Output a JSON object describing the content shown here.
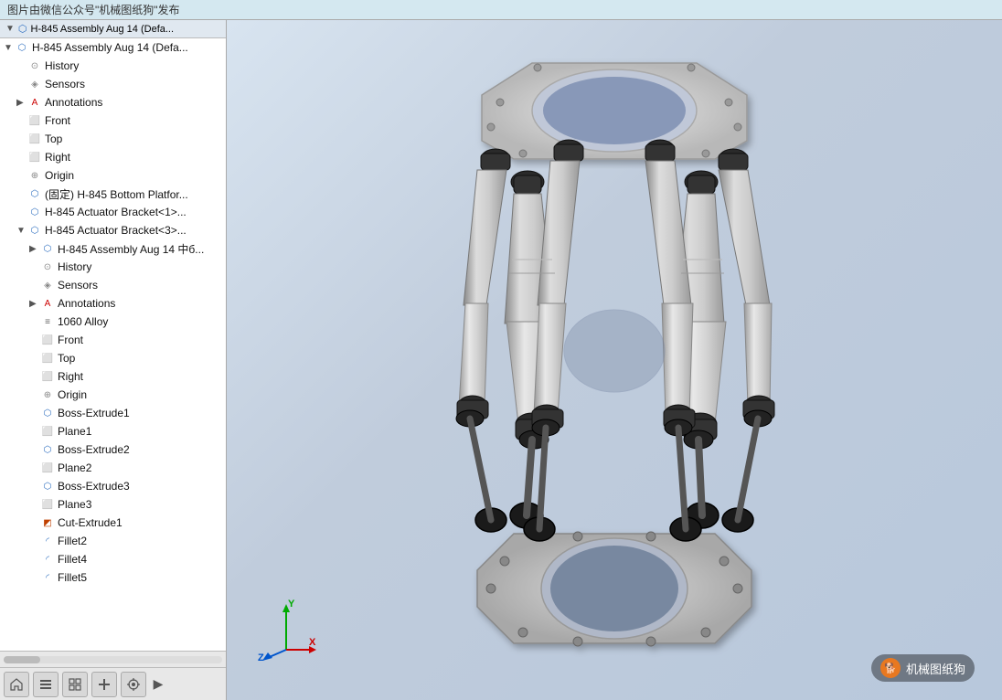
{
  "banner": {
    "text": "图片由微信公众号\"机械图纸狗\"发布"
  },
  "sidebar": {
    "header": {
      "title": "H-845 Assembly Aug 14  (Defa..."
    },
    "items": [
      {
        "id": "root-assembly",
        "indent": 0,
        "arrow": "▼",
        "icon": "assembly",
        "label": "H-845 Assembly Aug 14  (Defa...",
        "level": 0
      },
      {
        "id": "history-1",
        "indent": 1,
        "arrow": "",
        "icon": "history",
        "label": "History",
        "level": 1
      },
      {
        "id": "sensors-1",
        "indent": 1,
        "arrow": "",
        "icon": "sensors",
        "label": "Sensors",
        "level": 1
      },
      {
        "id": "annotations-1",
        "indent": 1,
        "arrow": "▶",
        "icon": "annotations",
        "label": "Annotations",
        "level": 1
      },
      {
        "id": "front-1",
        "indent": 1,
        "arrow": "",
        "icon": "plane",
        "label": "Front",
        "level": 1
      },
      {
        "id": "top-1",
        "indent": 1,
        "arrow": "",
        "icon": "plane",
        "label": "Top",
        "level": 1
      },
      {
        "id": "right-1",
        "indent": 1,
        "arrow": "",
        "icon": "plane",
        "label": "Right",
        "level": 1
      },
      {
        "id": "origin-1",
        "indent": 1,
        "arrow": "",
        "icon": "origin",
        "label": "Origin",
        "level": 1
      },
      {
        "id": "bottom-platform",
        "indent": 1,
        "arrow": "",
        "icon": "component",
        "label": "(固定) H-845 Bottom Platfor...",
        "level": 1
      },
      {
        "id": "actuator-1",
        "indent": 1,
        "arrow": "",
        "icon": "component",
        "label": "H-845 Actuator Bracket<1>...",
        "level": 1
      },
      {
        "id": "actuator-3",
        "indent": 1,
        "arrow": "▼",
        "icon": "component",
        "label": "H-845 Actuator Bracket<3>...",
        "level": 1
      },
      {
        "id": "sub-assembly",
        "indent": 2,
        "arrow": "▶",
        "icon": "assembly",
        "label": "H-845 Assembly Aug 14 中б...",
        "level": 2
      },
      {
        "id": "history-2",
        "indent": 2,
        "arrow": "",
        "icon": "history",
        "label": "History",
        "level": 2
      },
      {
        "id": "sensors-2",
        "indent": 2,
        "arrow": "",
        "icon": "sensors",
        "label": "Sensors",
        "level": 2
      },
      {
        "id": "annotations-2",
        "indent": 2,
        "arrow": "▶",
        "icon": "annotations",
        "label": "Annotations",
        "level": 2
      },
      {
        "id": "material",
        "indent": 2,
        "arrow": "",
        "icon": "material",
        "label": "1060 Alloy",
        "level": 2
      },
      {
        "id": "front-2",
        "indent": 2,
        "arrow": "",
        "icon": "plane",
        "label": "Front",
        "level": 2
      },
      {
        "id": "top-2",
        "indent": 2,
        "arrow": "",
        "icon": "plane",
        "label": "Top",
        "level": 2
      },
      {
        "id": "right-2",
        "indent": 2,
        "arrow": "",
        "icon": "plane",
        "label": "Right",
        "level": 2
      },
      {
        "id": "origin-2",
        "indent": 2,
        "arrow": "",
        "icon": "origin",
        "label": "Origin",
        "level": 2
      },
      {
        "id": "boss-extrude1",
        "indent": 2,
        "arrow": "",
        "icon": "boss",
        "label": "Boss-Extrude1",
        "level": 2
      },
      {
        "id": "plane1",
        "indent": 2,
        "arrow": "",
        "icon": "plane-f",
        "label": "Plane1",
        "level": 2
      },
      {
        "id": "boss-extrude2",
        "indent": 2,
        "arrow": "",
        "icon": "boss",
        "label": "Boss-Extrude2",
        "level": 2
      },
      {
        "id": "plane2",
        "indent": 2,
        "arrow": "",
        "icon": "plane-f",
        "label": "Plane2",
        "level": 2
      },
      {
        "id": "boss-extrude3",
        "indent": 2,
        "arrow": "",
        "icon": "boss",
        "label": "Boss-Extrude3",
        "level": 2
      },
      {
        "id": "plane3",
        "indent": 2,
        "arrow": "",
        "icon": "plane-f",
        "label": "Plane3",
        "level": 2
      },
      {
        "id": "cut-extrude1",
        "indent": 2,
        "arrow": "",
        "icon": "cut",
        "label": "Cut-Extrude1",
        "level": 2
      },
      {
        "id": "fillet2",
        "indent": 2,
        "arrow": "",
        "icon": "fillet",
        "label": "Fillet2",
        "level": 2
      },
      {
        "id": "fillet4",
        "indent": 2,
        "arrow": "",
        "icon": "fillet",
        "label": "Fillet4",
        "level": 2
      },
      {
        "id": "fillet5",
        "indent": 2,
        "arrow": "",
        "icon": "fillet",
        "label": "Fillet5",
        "level": 2
      }
    ]
  },
  "toolbar": {
    "buttons": [
      "⊕",
      "☰",
      "⊡",
      "✛",
      "◎"
    ],
    "arrow": "▶"
  },
  "watermark": {
    "icon": "🐕",
    "text": "机械图纸狗"
  },
  "axes": {
    "x_label": "X",
    "y_label": "Y",
    "z_label": "Z"
  }
}
